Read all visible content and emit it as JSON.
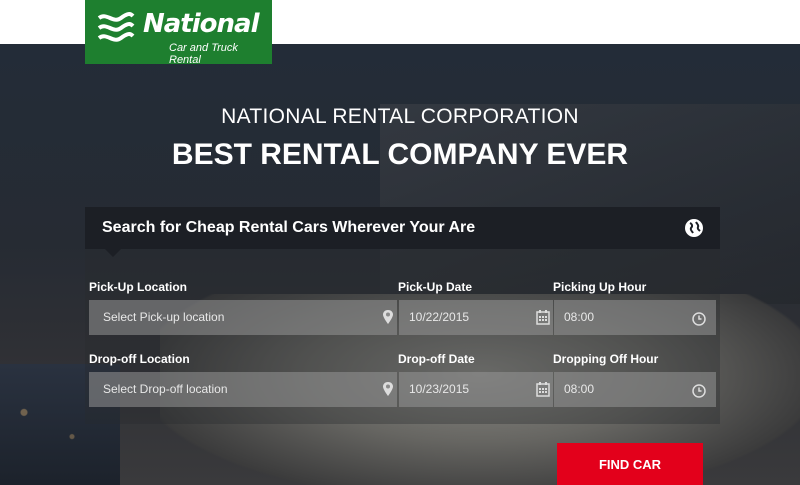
{
  "brand": {
    "name": "National",
    "reg": "®",
    "tagline": "Car and Truck Rental",
    "color": "#1e7f2f"
  },
  "nav": {
    "menu_icon": "hamburger-icon"
  },
  "hero": {
    "subtitle": "NATIONAL RENTAL CORPORATION",
    "title": "BEST RENTAL COMPANY EVER"
  },
  "search": {
    "heading": "Search for Cheap Rental Cars Wherever Your Are",
    "heading_icon": "globe-icon",
    "pickup_location": {
      "label": "Pick-Up Location",
      "placeholder": "Select Pick-up location"
    },
    "pickup_date": {
      "label": "Pick-Up Date",
      "value": "10/22/2015"
    },
    "pickup_hour": {
      "label": "Picking Up Hour",
      "value": "08:00"
    },
    "dropoff_location": {
      "label": "Drop-off Location",
      "placeholder": "Select Drop-off location"
    },
    "dropoff_date": {
      "label": "Drop-off Date",
      "value": "10/23/2015"
    },
    "dropoff_hour": {
      "label": "Dropping Off Hour",
      "value": "08:00"
    },
    "submit_label": "FIND CAR",
    "accent": "#e3001b"
  }
}
